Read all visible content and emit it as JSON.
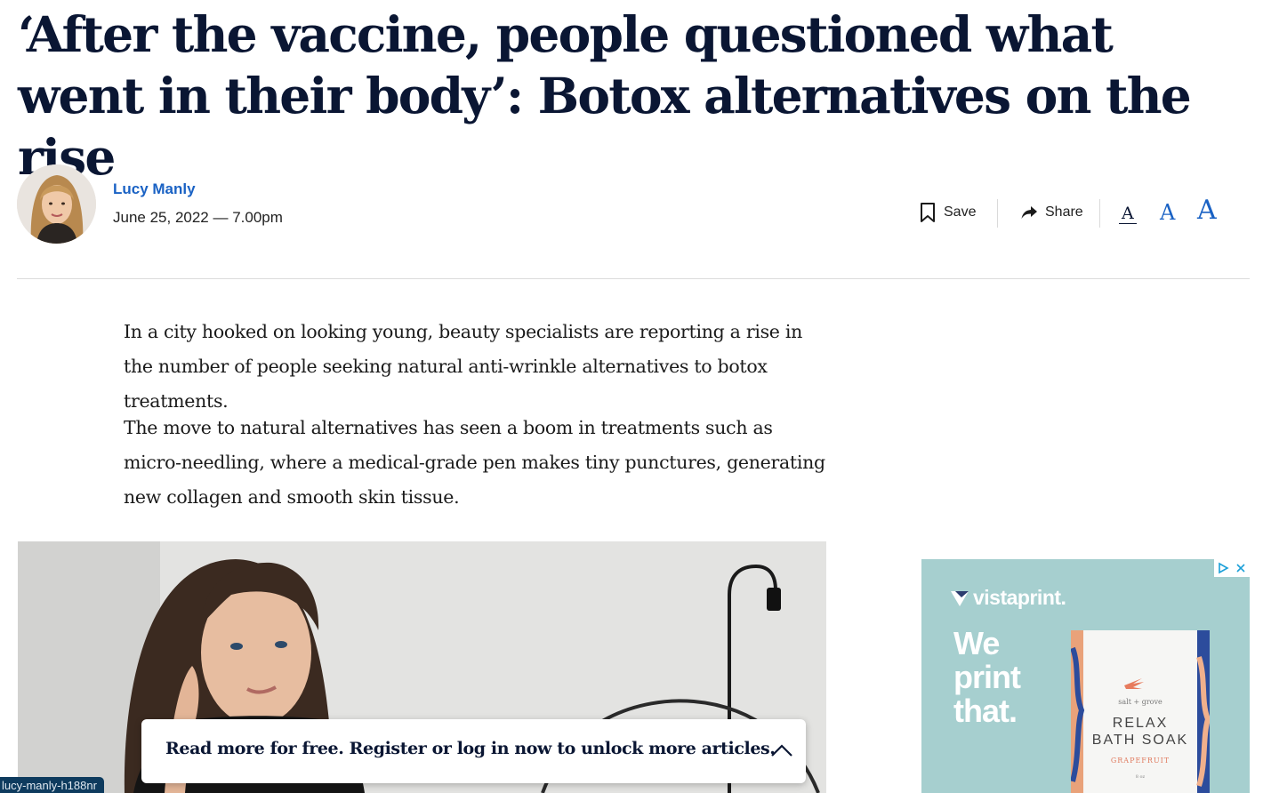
{
  "article": {
    "headline": "‘After the vaccine, people questioned what went in their body’: Botox alternatives on the rise",
    "author": "Lucy Manly",
    "date": "June 25, 2022 — 7.00pm",
    "paragraphs": [
      "In a city hooked on looking young, beauty specialists are reporting a rise in the number of people seeking natural anti-wrinkle alternatives to botox treatments.",
      "The move to natural alternatives has seen a boom in treatments such as micro-needling, where a medical-grade pen makes tiny punctures, generating new collagen and smooth skin tissue."
    ]
  },
  "toolbar": {
    "save_label": "Save",
    "share_label": "Share",
    "font_size_labels": [
      "A",
      "A",
      "A"
    ]
  },
  "ad": {
    "brand": "vistaprint.",
    "slogan": "We\nprint\nthat.",
    "product_brand": "salt + grove",
    "product_line1": "RELAX",
    "product_line2": "BATH SOAK",
    "product_variant": "GRAPEFRUIT",
    "product_size": "8 oz"
  },
  "paywall": {
    "text": "Read more for free. Register or log in now to unlock more articles."
  },
  "status": {
    "url_tooltip": "lucy-manly-h188nr"
  },
  "colors": {
    "headline": "#0a1633",
    "link": "#1a62c4",
    "ad_background": "#a6cfcf"
  }
}
